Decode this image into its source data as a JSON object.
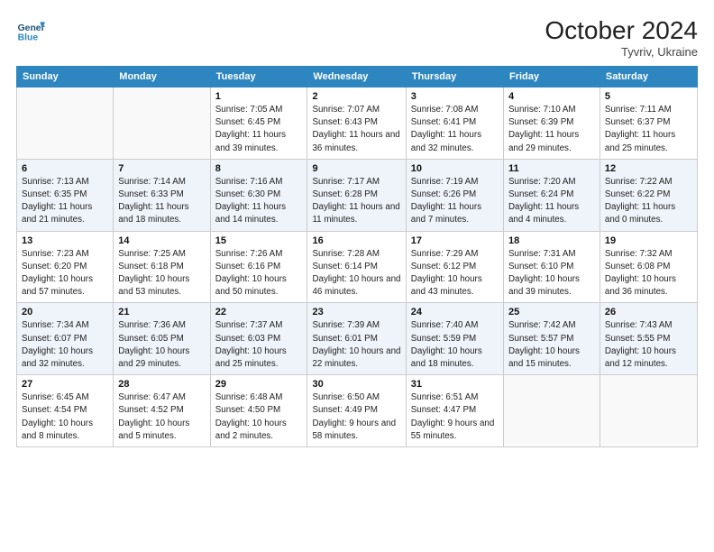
{
  "header": {
    "logo_line1": "General",
    "logo_line2": "Blue",
    "month": "October 2024",
    "location": "Tyvriv, Ukraine"
  },
  "weekdays": [
    "Sunday",
    "Monday",
    "Tuesday",
    "Wednesday",
    "Thursday",
    "Friday",
    "Saturday"
  ],
  "weeks": [
    [
      {
        "day": "",
        "detail": ""
      },
      {
        "day": "",
        "detail": ""
      },
      {
        "day": "1",
        "detail": "Sunrise: 7:05 AM\nSunset: 6:45 PM\nDaylight: 11 hours and 39 minutes."
      },
      {
        "day": "2",
        "detail": "Sunrise: 7:07 AM\nSunset: 6:43 PM\nDaylight: 11 hours and 36 minutes."
      },
      {
        "day": "3",
        "detail": "Sunrise: 7:08 AM\nSunset: 6:41 PM\nDaylight: 11 hours and 32 minutes."
      },
      {
        "day": "4",
        "detail": "Sunrise: 7:10 AM\nSunset: 6:39 PM\nDaylight: 11 hours and 29 minutes."
      },
      {
        "day": "5",
        "detail": "Sunrise: 7:11 AM\nSunset: 6:37 PM\nDaylight: 11 hours and 25 minutes."
      }
    ],
    [
      {
        "day": "6",
        "detail": "Sunrise: 7:13 AM\nSunset: 6:35 PM\nDaylight: 11 hours and 21 minutes."
      },
      {
        "day": "7",
        "detail": "Sunrise: 7:14 AM\nSunset: 6:33 PM\nDaylight: 11 hours and 18 minutes."
      },
      {
        "day": "8",
        "detail": "Sunrise: 7:16 AM\nSunset: 6:30 PM\nDaylight: 11 hours and 14 minutes."
      },
      {
        "day": "9",
        "detail": "Sunrise: 7:17 AM\nSunset: 6:28 PM\nDaylight: 11 hours and 11 minutes."
      },
      {
        "day": "10",
        "detail": "Sunrise: 7:19 AM\nSunset: 6:26 PM\nDaylight: 11 hours and 7 minutes."
      },
      {
        "day": "11",
        "detail": "Sunrise: 7:20 AM\nSunset: 6:24 PM\nDaylight: 11 hours and 4 minutes."
      },
      {
        "day": "12",
        "detail": "Sunrise: 7:22 AM\nSunset: 6:22 PM\nDaylight: 11 hours and 0 minutes."
      }
    ],
    [
      {
        "day": "13",
        "detail": "Sunrise: 7:23 AM\nSunset: 6:20 PM\nDaylight: 10 hours and 57 minutes."
      },
      {
        "day": "14",
        "detail": "Sunrise: 7:25 AM\nSunset: 6:18 PM\nDaylight: 10 hours and 53 minutes."
      },
      {
        "day": "15",
        "detail": "Sunrise: 7:26 AM\nSunset: 6:16 PM\nDaylight: 10 hours and 50 minutes."
      },
      {
        "day": "16",
        "detail": "Sunrise: 7:28 AM\nSunset: 6:14 PM\nDaylight: 10 hours and 46 minutes."
      },
      {
        "day": "17",
        "detail": "Sunrise: 7:29 AM\nSunset: 6:12 PM\nDaylight: 10 hours and 43 minutes."
      },
      {
        "day": "18",
        "detail": "Sunrise: 7:31 AM\nSunset: 6:10 PM\nDaylight: 10 hours and 39 minutes."
      },
      {
        "day": "19",
        "detail": "Sunrise: 7:32 AM\nSunset: 6:08 PM\nDaylight: 10 hours and 36 minutes."
      }
    ],
    [
      {
        "day": "20",
        "detail": "Sunrise: 7:34 AM\nSunset: 6:07 PM\nDaylight: 10 hours and 32 minutes."
      },
      {
        "day": "21",
        "detail": "Sunrise: 7:36 AM\nSunset: 6:05 PM\nDaylight: 10 hours and 29 minutes."
      },
      {
        "day": "22",
        "detail": "Sunrise: 7:37 AM\nSunset: 6:03 PM\nDaylight: 10 hours and 25 minutes."
      },
      {
        "day": "23",
        "detail": "Sunrise: 7:39 AM\nSunset: 6:01 PM\nDaylight: 10 hours and 22 minutes."
      },
      {
        "day": "24",
        "detail": "Sunrise: 7:40 AM\nSunset: 5:59 PM\nDaylight: 10 hours and 18 minutes."
      },
      {
        "day": "25",
        "detail": "Sunrise: 7:42 AM\nSunset: 5:57 PM\nDaylight: 10 hours and 15 minutes."
      },
      {
        "day": "26",
        "detail": "Sunrise: 7:43 AM\nSunset: 5:55 PM\nDaylight: 10 hours and 12 minutes."
      }
    ],
    [
      {
        "day": "27",
        "detail": "Sunrise: 6:45 AM\nSunset: 4:54 PM\nDaylight: 10 hours and 8 minutes."
      },
      {
        "day": "28",
        "detail": "Sunrise: 6:47 AM\nSunset: 4:52 PM\nDaylight: 10 hours and 5 minutes."
      },
      {
        "day": "29",
        "detail": "Sunrise: 6:48 AM\nSunset: 4:50 PM\nDaylight: 10 hours and 2 minutes."
      },
      {
        "day": "30",
        "detail": "Sunrise: 6:50 AM\nSunset: 4:49 PM\nDaylight: 9 hours and 58 minutes."
      },
      {
        "day": "31",
        "detail": "Sunrise: 6:51 AM\nSunset: 4:47 PM\nDaylight: 9 hours and 55 minutes."
      },
      {
        "day": "",
        "detail": ""
      },
      {
        "day": "",
        "detail": ""
      }
    ]
  ]
}
